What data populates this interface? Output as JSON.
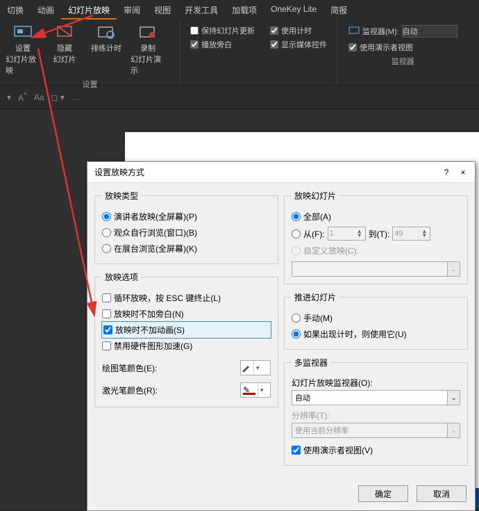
{
  "ribbon": {
    "tabs": [
      "切换",
      "动画",
      "幻灯片放映",
      "审阅",
      "视图",
      "开发工具",
      "加载项",
      "OneKey Lite",
      "简报"
    ],
    "activeTab": "幻灯片放映",
    "buttons": {
      "setup": {
        "line1": "设置",
        "line2": "幻灯片放映"
      },
      "hide": {
        "line1": "隐藏",
        "line2": "幻灯片"
      },
      "rehearse": {
        "line1": "排练计时",
        "line2": ""
      },
      "record": {
        "line1": "录制",
        "line2": "幻灯片演示"
      }
    },
    "checksA": [
      {
        "label": "保持幻灯片更新",
        "checked": false
      },
      {
        "label": "播放旁白",
        "checked": true
      }
    ],
    "checksB": [
      {
        "label": "使用计时",
        "checked": true
      },
      {
        "label": "显示媒体控件",
        "checked": true
      }
    ],
    "groupLabel1": "设置",
    "monitor": {
      "label": "监视器(M):",
      "value": "自动",
      "presenterView": "使用演示者视图"
    },
    "groupLabel2": "监视器"
  },
  "dialog": {
    "title": "设置放映方式",
    "help": "?",
    "close": "×",
    "showType": {
      "legend": "放映类型",
      "o1": "演讲者放映(全屏幕)(P)",
      "o2": "观众自行浏览(窗口)(B)",
      "o3": "在展台浏览(全屏幕)(K)",
      "selected": 0
    },
    "showOptions": {
      "legend": "放映选项",
      "c1": "循环放映，按 ESC 键终止(L)",
      "c2": "放映时不加旁白(N)",
      "c3": "放映时不加动画(S)",
      "c4": "禁用硬件图形加速(G)",
      "c3checked": true,
      "penColor": "绘图笔颜色(E):",
      "laserColor": "激光笔颜色(R):"
    },
    "showSlides": {
      "legend": "放映幻灯片",
      "all": "全部(A)",
      "fromLbl": "从(F):",
      "toLbl": "到(T):",
      "from": "1",
      "to": "49",
      "custom": "自定义放映(C):",
      "selected": 0
    },
    "advance": {
      "legend": "推进幻灯片",
      "manual": "手动(M)",
      "timings": "如果出现计时，则使用它(U)",
      "selected": 1
    },
    "multiMon": {
      "legend": "多监视器",
      "monLbl": "幻灯片放映监视器(O):",
      "monVal": "自动",
      "resLbl": "分辨率(T):",
      "resVal": "使用当前分辨率",
      "presenter": "使用演示者视图(V)",
      "presenterChecked": true
    },
    "buttons": {
      "ok": "确定",
      "cancel": "取消"
    }
  }
}
